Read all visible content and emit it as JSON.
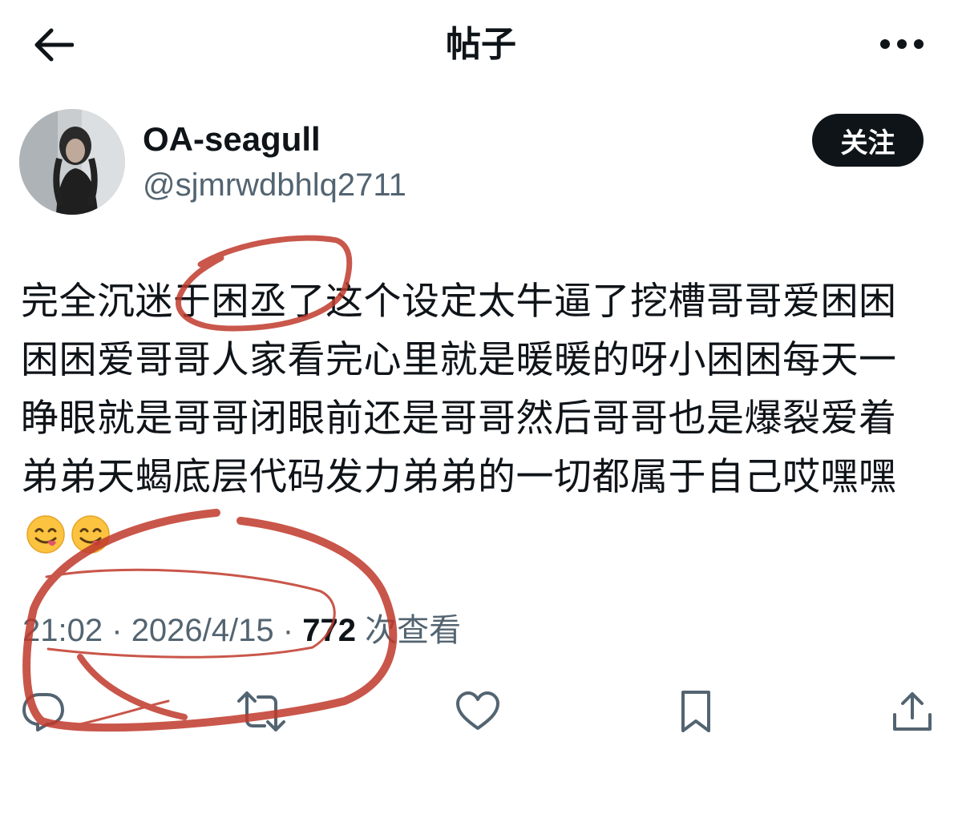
{
  "header": {
    "title": "帖子",
    "back_icon": "arrow-left-icon",
    "more_icon": "more-horizontal-icon"
  },
  "author": {
    "display_name": "OA-seagull",
    "handle": "@sjmrwdbhlq2711",
    "follow_label": "关注"
  },
  "post": {
    "text": "完全沉迷于困丞了这个设定太牛逼了挖槽哥哥爱困困困困爱哥哥人家看完心里就是暖暖的呀小困困每天一睁眼就是哥哥闭眼前还是哥哥然后哥哥也是爆裂爱着弟弟天蝎底层代码发力弟弟的一切都属于自己哎嘿嘿",
    "emojis": [
      "face-savoring-food",
      "face-savoring-food"
    ]
  },
  "meta": {
    "time": "21:02",
    "date": "2026/4/15",
    "views": "772",
    "views_label": "次查看",
    "separator": "·"
  },
  "actions": [
    "reply-icon",
    "repost-icon",
    "like-icon",
    "bookmark-icon",
    "share-icon"
  ],
  "colors": {
    "text": "#0f1419",
    "secondary": "#536471",
    "button": "#0f1419",
    "annotation": "#c0392b"
  }
}
